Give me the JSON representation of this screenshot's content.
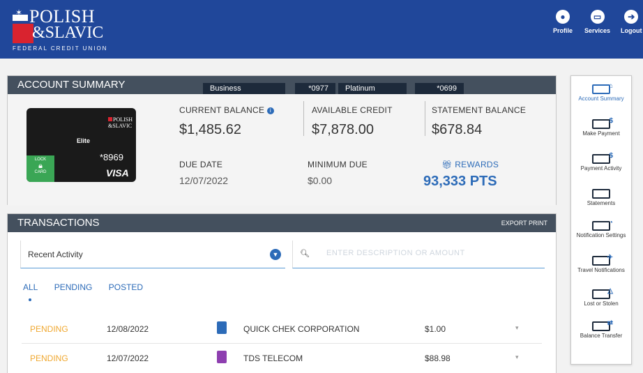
{
  "brand": {
    "line1": "POLISH",
    "line2": "&SLAVIC",
    "line3": "FEDERAL CREDIT UNION"
  },
  "topnav": [
    {
      "label": "Profile",
      "icon": "person-icon"
    },
    {
      "label": "Services",
      "icon": "card-icon"
    },
    {
      "label": "Logout",
      "icon": "logout-icon"
    }
  ],
  "summary": {
    "title": "ACCOUNT SUMMARY",
    "tabs": [
      "Business",
      "*0977",
      "Platinum",
      "*0699"
    ],
    "card": {
      "tier": "Elite",
      "number": "*8969",
      "network": "VISA",
      "lock_label": "LOCK",
      "lock_sub": "CARD",
      "brand1": "POLISH",
      "brand2": "&SLAVIC"
    },
    "current_balance": {
      "label": "CURRENT BALANCE",
      "value": "$1,485.62"
    },
    "available_credit": {
      "label": "AVAILABLE CREDIT",
      "value": "$7,878.00"
    },
    "statement_balance": {
      "label": "STATEMENT BALANCE",
      "value": "$678.84"
    },
    "due_date": {
      "label": "DUE DATE",
      "value": "12/07/2022"
    },
    "minimum_due": {
      "label": "MINIMUM DUE",
      "value": "$0.00"
    },
    "rewards": {
      "label": "REWARDS",
      "value": "93,333 PTS"
    }
  },
  "transactions": {
    "title": "TRANSACTIONS",
    "export_label": "EXPORT",
    "print_label": "PRINT",
    "filter_value": "Recent Activity",
    "search_placeholder": "ENTER DESCRIPTION OR AMOUNT",
    "tabs": [
      "ALL",
      "PENDING",
      "POSTED"
    ],
    "rows": [
      {
        "status": "PENDING",
        "date": "12/08/2022",
        "description": "QUICK CHEK CORPORATION",
        "amount": "$1.00",
        "icon": "fuel-icon",
        "icon_color": "#2c6bb8"
      },
      {
        "status": "PENDING",
        "date": "12/07/2022",
        "description": "TDS TELECOM",
        "amount": "$88.98",
        "icon": "bag-icon",
        "icon_color": "#8e3fb0"
      }
    ]
  },
  "sidebar": [
    {
      "label": "Account Summary",
      "active": true,
      "glyph": "⌂"
    },
    {
      "label": "Make Payment",
      "active": false,
      "glyph": "$"
    },
    {
      "label": "Payment Activity",
      "active": false,
      "glyph": "$"
    },
    {
      "label": "Statements",
      "active": false,
      "glyph": ""
    },
    {
      "label": "Notification Settings",
      "active": false,
      "glyph": "◔"
    },
    {
      "label": "Travel Notifications",
      "active": false,
      "glyph": "✈"
    },
    {
      "label": "Lost or Stolen",
      "active": false,
      "glyph": "△"
    },
    {
      "label": "Balance Transfer",
      "active": false,
      "glyph": "⇄"
    }
  ]
}
